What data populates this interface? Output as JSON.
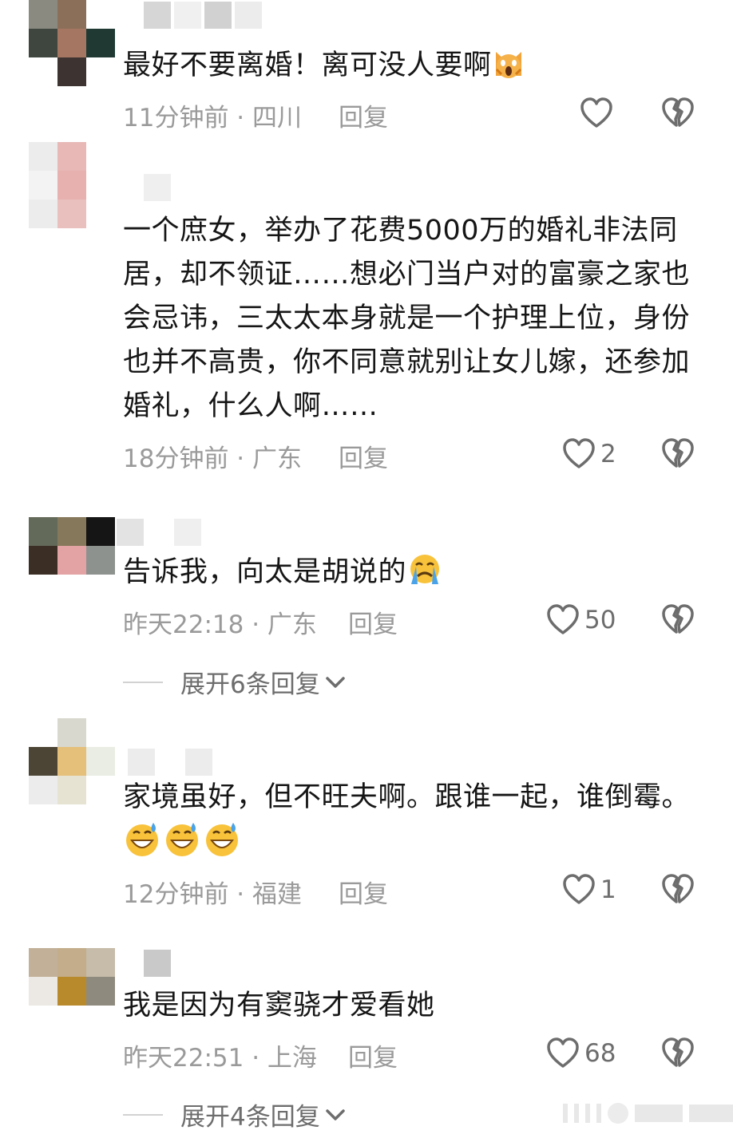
{
  "comments": [
    {
      "text": "最好不要离婚！离可没人要啊",
      "time": "11分钟前",
      "location": "四川",
      "reply_label": "回复",
      "likes": "",
      "avatar_colors": [
        "#8a8a80",
        "#8c6f58",
        "#ffffff",
        "#3f463f",
        "#a57763",
        "#203a33",
        "#ffffff",
        "#3d3330",
        "#ffffff"
      ],
      "emoji": "scream-cat-icon"
    },
    {
      "text": "一个庶女，举办了花费5000万的婚礼非法同居，却不领证……想必门当户对的富豪之家也会忌讳，三太太本身就是一个护理上位，身份也并不高贵，你不同意就别让女儿嫁，还参加婚礼，什么人啊……",
      "time": "18分钟前",
      "location": "广东",
      "reply_label": "回复",
      "likes": "2",
      "avatar_colors": [
        "#ececec",
        "#e7b8b6",
        "#ffffff",
        "#f3f3f3",
        "#e7b1af",
        "#ffffff",
        "#ececec",
        "#e9c0bd",
        "#ffffff"
      ]
    },
    {
      "text": "告诉我，向太是胡说的",
      "time": "昨天22:18",
      "location": "广东",
      "reply_label": "回复",
      "likes": "50",
      "expand_label": "展开6条回复",
      "avatar_colors": [
        "#646a5a",
        "#86785a",
        "#151515",
        "#3b2f25",
        "#e3a3a5",
        "#8e928f",
        "#ffffff",
        "#ffffff",
        "#ffffff"
      ],
      "emoji": "crying-face-icon"
    },
    {
      "text": "家境虽好，但不旺夫啊。跟谁一起，谁倒霉。",
      "time": "12分钟前",
      "location": "福建",
      "reply_label": "回复",
      "likes": "1",
      "avatar_colors": [
        "#ffffff",
        "#d8d8cf",
        "#ffffff",
        "#4c4535",
        "#e5c07a",
        "#e9ede3",
        "#ececec",
        "#e7e3d3",
        "#ffffff"
      ],
      "emoji": "grin-sweat-icon"
    },
    {
      "text": "我是因为有窦骁才爱看她",
      "time": "昨天22:51",
      "location": "上海",
      "reply_label": "回复",
      "likes": "68",
      "expand_label": "展开4条回复",
      "avatar_colors": [
        "#c2b098",
        "#c3ad8a",
        "#c6bca9",
        "#ece8e3",
        "#b98a2c",
        "#8f8a7e",
        "#ffffff",
        "#ffffff",
        "#ffffff"
      ]
    }
  ],
  "colors": {
    "text": "#161616",
    "meta": "#9a9a9a",
    "icon": "#6d6d6d"
  }
}
